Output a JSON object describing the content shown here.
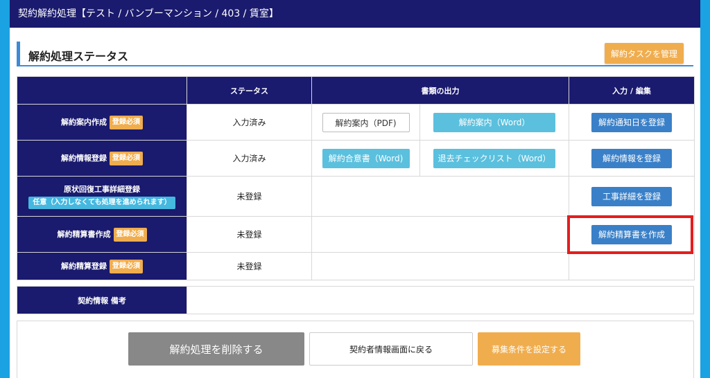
{
  "header": {
    "title": "契約解約処理【テスト / バンブーマンション / 403 / 賃室】"
  },
  "section": {
    "title": "解約処理ステータス",
    "task_button": "解約タスクを管理"
  },
  "table": {
    "columns": [
      "",
      "ステータス",
      "書類の出力",
      "入力 / 編集"
    ],
    "rows": [
      {
        "label": "解約案内作成",
        "badge": "登録必須",
        "status": "入力済み",
        "doc1": "解約案内（PDF)",
        "doc2": "解約案内（Word）",
        "action": "解約通知日を登録"
      },
      {
        "label": "解約情報登録",
        "badge": "登録必須",
        "status": "入力済み",
        "doc1": "解約合意書（Word)",
        "doc2": "退去チェックリスト（Word）",
        "action": "解約情報を登録"
      },
      {
        "label": "原状回復工事詳細登録",
        "optional": "任意（入力しなくても処理を進められます）",
        "status": "未登録",
        "action": "工事詳細を登録"
      },
      {
        "label": "解約精算書作成",
        "badge": "登録必須",
        "status": "未登録",
        "action": "解約精算書を作成"
      },
      {
        "label": "解約精算登録",
        "badge": "登録必須",
        "status": "未登録"
      }
    ]
  },
  "remarks": {
    "label": "契約情報 備考",
    "value": ""
  },
  "footer": {
    "delete_button": "解約処理を削除する",
    "back_button": "契約者情報画面に戻る",
    "recruit_button": "募集条件を設定する"
  },
  "colors": {
    "navy": "#1a1a6e",
    "accent_blue": "#3a80c8",
    "sky": "#5bc0de",
    "orange": "#f0ad4e",
    "highlight_red": "#e41d1d",
    "background": "#1ba2e2"
  }
}
